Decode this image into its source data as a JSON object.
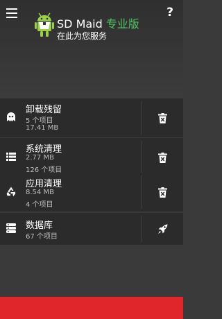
{
  "header": {
    "app_name": "SD Maid",
    "pro_label": "专业版",
    "subtitle": "在此为您服务",
    "help_label": "?"
  },
  "cards": [
    {
      "title": "卸载残留",
      "line1": "5 个项目",
      "line2": "17.41 MB",
      "icon": "ghost-icon",
      "action_icon": "delete-icon"
    },
    {
      "title": "系统清理",
      "line1": "2.77 MB",
      "line2": "126 个项目",
      "icon": "list-icon",
      "action_icon": "delete-icon"
    },
    {
      "title": "应用清理",
      "line1": "8.54 MB",
      "line2": "4 个项目",
      "icon": "recycle-icon",
      "action_icon": "delete-icon"
    },
    {
      "title": "数据库",
      "line1": "67 个项目",
      "icon": "database-icon",
      "action_icon": "rocket-icon"
    }
  ],
  "colors": {
    "accent": "#4fc463",
    "footer": "#e0262b",
    "card": "#2b2b2b",
    "background": "#3a3a3a"
  }
}
